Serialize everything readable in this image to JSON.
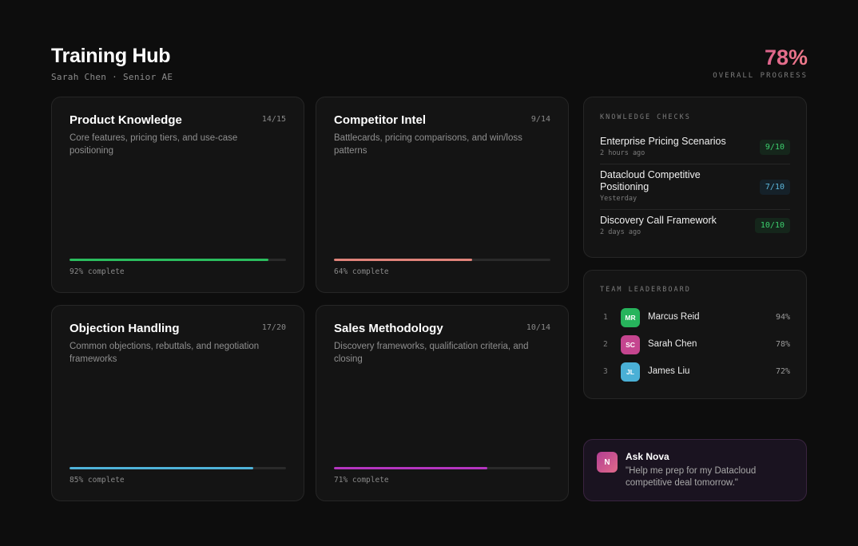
{
  "header": {
    "title": "Training Hub",
    "subtitle": "Sarah Chen · Senior AE",
    "overall_value": "78%",
    "overall_label": "OVERALL PROGRESS"
  },
  "modules": [
    {
      "title": "Product Knowledge",
      "count": "14/15",
      "description": "Core features, pricing tiers, and use-case positioning",
      "progress": 0.92,
      "progress_label": "92% complete",
      "color": "#2bbd5e"
    },
    {
      "title": "Competitor Intel",
      "count": "9/14",
      "description": "Battlecards, pricing comparisons, and win/loss patterns",
      "progress": 0.64,
      "progress_label": "64% complete",
      "color": "#e0837a"
    },
    {
      "title": "Objection Handling",
      "count": "17/20",
      "description": "Common objections, rebuttals, and negotiation frameworks",
      "progress": 0.85,
      "progress_label": "85% complete",
      "color": "#4fb3d9"
    },
    {
      "title": "Sales Methodology",
      "count": "10/14",
      "description": "Discovery frameworks, qualification criteria, and closing",
      "progress": 0.71,
      "progress_label": "71% complete",
      "color": "#b535c0"
    }
  ],
  "knowledge_checks": {
    "label": "KNOWLEDGE CHECKS",
    "items": [
      {
        "name": "Enterprise Pricing Scenarios",
        "time": "2 hours ago",
        "score": "9/10",
        "score_color": "#3ccf6e",
        "score_bg": "#15261b"
      },
      {
        "name": "Datacloud Competitive Positioning",
        "time": "Yesterday",
        "score": "7/10",
        "score_color": "#5cb8dd",
        "score_bg": "#152129"
      },
      {
        "name": "Discovery Call Framework",
        "time": "2 days ago",
        "score": "10/10",
        "score_color": "#3ccf6e",
        "score_bg": "#15261b"
      }
    ]
  },
  "leaderboard": {
    "label": "TEAM LEADERBOARD",
    "items": [
      {
        "rank": "1",
        "initials": "MR",
        "name": "Marcus Reid",
        "pct": "94%",
        "color": "#27b45c"
      },
      {
        "rank": "2",
        "initials": "SC",
        "name": "Sarah Chen",
        "pct": "78%",
        "color": "#c5458f"
      },
      {
        "rank": "3",
        "initials": "JL",
        "name": "James Liu",
        "pct": "72%",
        "color": "#4ab0d6"
      }
    ]
  },
  "assistant": {
    "icon_letter": "N",
    "title": "Ask Nova",
    "prompt": "\"Help me prep for my Datacloud competitive deal tomorrow.\""
  }
}
